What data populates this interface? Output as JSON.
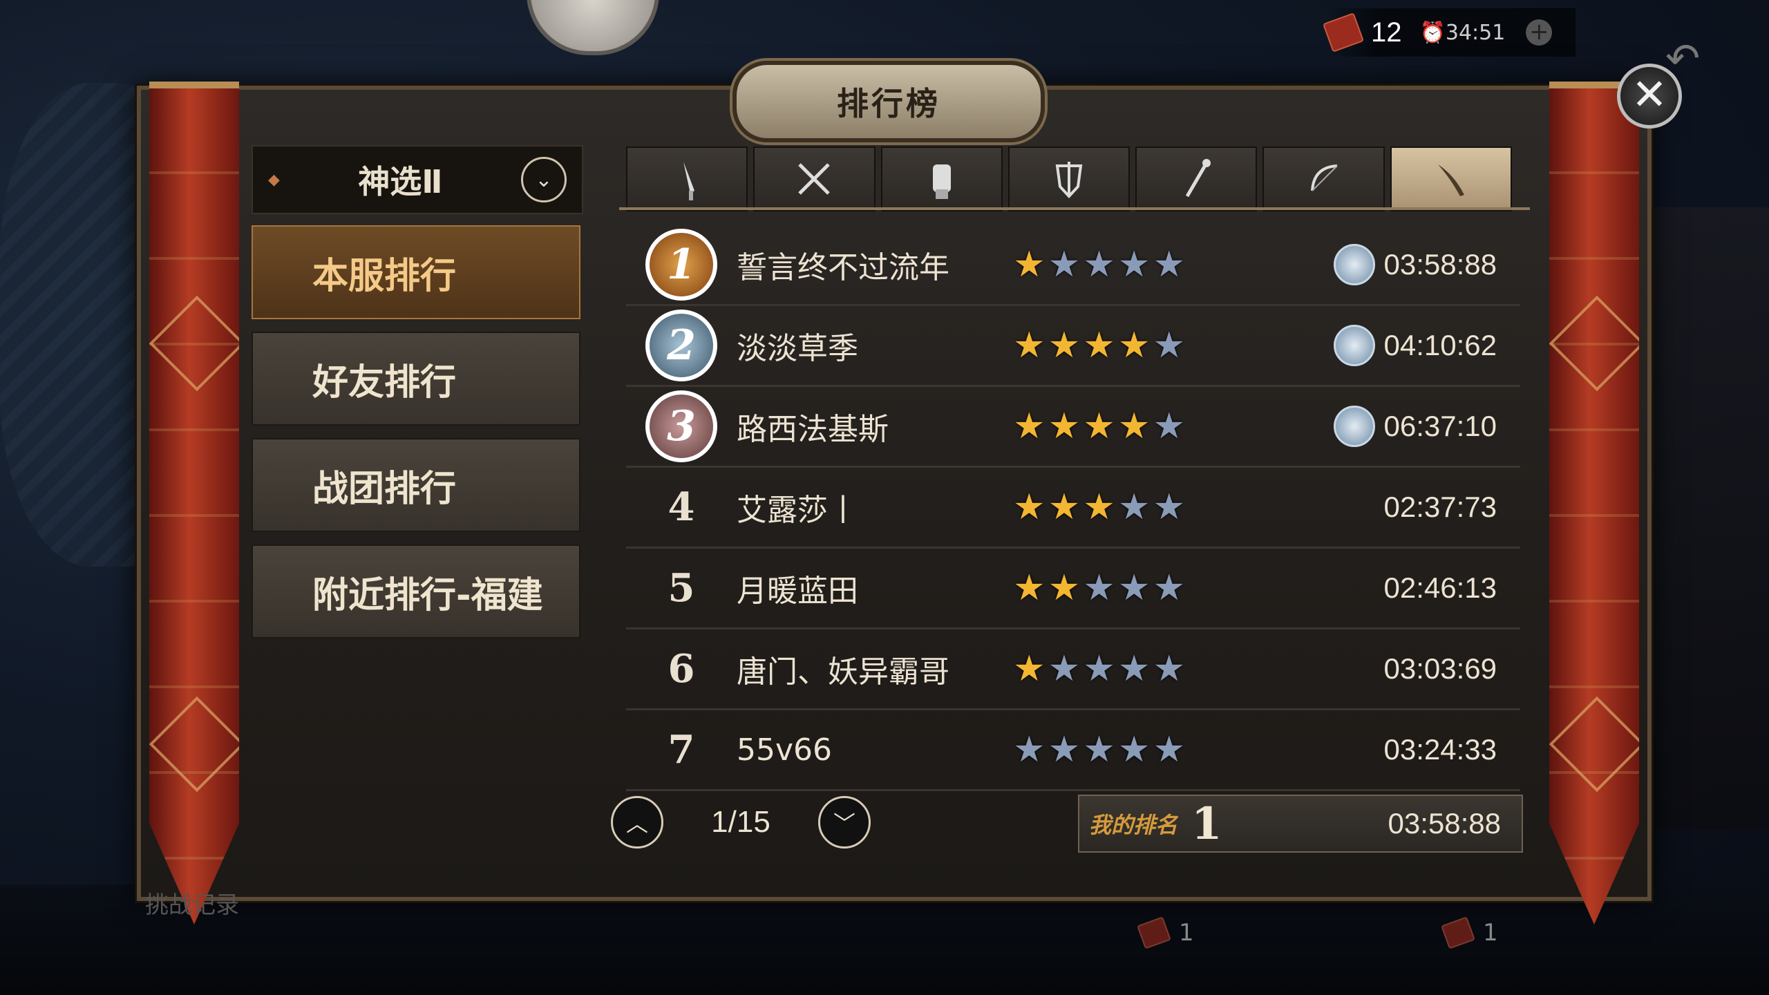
{
  "colors": {
    "accent": "#f5c988",
    "active_tab": "#d6c3a1",
    "star_on": "#f3b632",
    "star_off": "#8a9bb8",
    "banner_red": "#b53c24"
  },
  "topbar": {
    "ticket_count": "12",
    "timer": "⏰34:51",
    "plus": "+"
  },
  "panel": {
    "title": "排行榜",
    "close_glyph": "✕"
  },
  "server_select": {
    "label": "神选Ⅱ",
    "dropdown_glyph": "⌄"
  },
  "side_menu": [
    {
      "label": "本服排行",
      "active": true
    },
    {
      "label": "好友排行",
      "active": false
    },
    {
      "label": "战团排行",
      "active": false
    },
    {
      "label": "附近排行-福建",
      "active": false
    }
  ],
  "weapon_tabs": [
    {
      "icon": "dagger-icon"
    },
    {
      "icon": "crossed-swords-icon"
    },
    {
      "icon": "gauntlet-icon"
    },
    {
      "icon": "shield-sword-icon"
    },
    {
      "icon": "staff-icon"
    },
    {
      "icon": "bow-icon"
    },
    {
      "icon": "blade-icon",
      "active": true
    }
  ],
  "rankings": [
    {
      "rank": "1",
      "name": "誓言终不过流年",
      "stars": 1,
      "time": "03:58:88",
      "badge": true
    },
    {
      "rank": "2",
      "name": "淡淡草季",
      "stars": 4,
      "time": "04:10:62",
      "badge": true
    },
    {
      "rank": "3",
      "name": "路西法基斯",
      "stars": 4,
      "time": "06:37:10",
      "badge": true
    },
    {
      "rank": "4",
      "name": "艾露莎丨",
      "stars": 3,
      "time": "02:37:73",
      "badge": false
    },
    {
      "rank": "5",
      "name": "月暖蓝田",
      "stars": 2,
      "time": "02:46:13",
      "badge": false
    },
    {
      "rank": "6",
      "name": "唐门、妖异霸哥",
      "stars": 1,
      "time": "03:03:69",
      "badge": false
    },
    {
      "rank": "7",
      "name": "55v66",
      "stars": 0,
      "time": "03:24:33",
      "badge": false
    }
  ],
  "pager": {
    "text": "1/15",
    "up_glyph": "︿",
    "down_glyph": "﹀"
  },
  "my_rank": {
    "label": "我的排名",
    "rank": "1",
    "time": "03:58:88"
  },
  "background": {
    "under_left": "挑战记录",
    "cost_1": "1",
    "cost_2": "1"
  }
}
